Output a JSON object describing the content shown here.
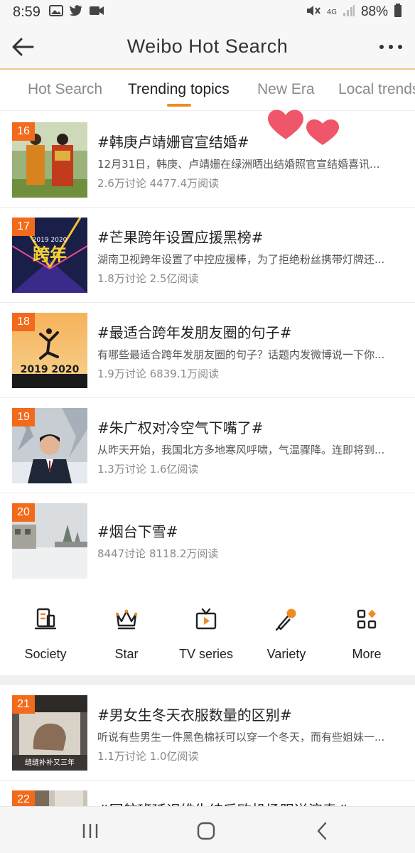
{
  "status_bar": {
    "time": "8:59",
    "network": "4G",
    "battery": "88%"
  },
  "header": {
    "title": "Weibo Hot Search",
    "back_icon": "arrow-left-icon",
    "more_icon": "more-dots-icon"
  },
  "tabs": [
    {
      "label": "Hot Search",
      "active": false
    },
    {
      "label": "Trending topics",
      "active": true
    },
    {
      "label": "New Era",
      "active": false
    },
    {
      "label": "Local trends",
      "active": false
    }
  ],
  "colors": {
    "accent": "#f08a24",
    "rank_badge": "#f26a1b",
    "heart": "#f0566a"
  },
  "hot_list": [
    {
      "rank": "16",
      "title": "#韩庚卢靖姗官宣结婚#",
      "desc": "12月31日，韩庚、卢靖姗在绿洲晒出结婚照官宣结婚喜讯...",
      "stats": "2.6万讨论 4477.4万阅读"
    },
    {
      "rank": "17",
      "title": "#芒果跨年设置应援黑榜#",
      "desc": "湖南卫视跨年设置了中控应援棒，为了拒绝粉丝携带灯牌还...",
      "stats": "1.8万讨论 2.5亿阅读"
    },
    {
      "rank": "18",
      "title": "#最适合跨年发朋友圈的句子#",
      "desc": "有哪些最适合跨年发朋友圈的句子？话题内发微博说一下你...",
      "stats": "1.9万讨论 6839.1万阅读",
      "thumb_text": "2019 2020"
    },
    {
      "rank": "19",
      "title": "#朱广权对冷空气下嘴了#",
      "desc": "从昨天开始，我国北方多地寒风呼啸，气温骤降。连即将到...",
      "stats": "1.3万讨论 1.6亿阅读"
    },
    {
      "rank": "20",
      "title": "#烟台下雪#",
      "desc": "",
      "stats": "8447讨论 8118.2万阅读"
    }
  ],
  "categories": [
    {
      "label": "Society",
      "icon": "document-icon"
    },
    {
      "label": "Star",
      "icon": "crown-icon"
    },
    {
      "label": "TV series",
      "icon": "tv-icon"
    },
    {
      "label": "Variety",
      "icon": "microphone-icon"
    },
    {
      "label": "More",
      "icon": "grid-icon"
    }
  ],
  "hot_list_2": [
    {
      "rank": "21",
      "title": "#男女生冬天衣服数量的区别#",
      "desc": "听说有些男生一件黑色棉袄可以穿一个冬天，而有些姐妹一...",
      "stats": "1.1万讨论 1.0亿阅读",
      "thumb_caption": "缝缝补补又三年"
    },
    {
      "rank": "22",
      "title": "#国航班延误维生结后欧机场服送演奏#"
    }
  ],
  "nav_bar": {
    "recent_icon": "recent-apps-icon",
    "home_icon": "home-icon",
    "back_icon": "back-chevron-icon"
  }
}
